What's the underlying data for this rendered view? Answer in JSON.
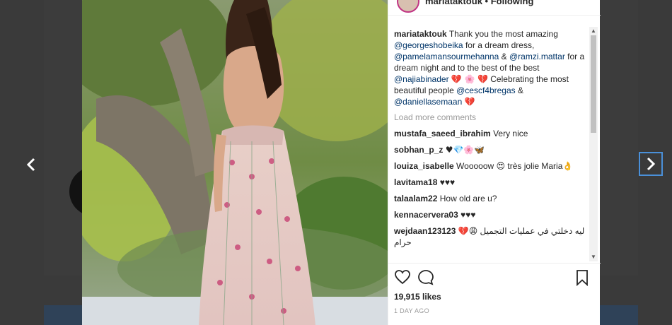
{
  "header": {
    "username": "mariataktouk",
    "separator": "•",
    "follow_label": "Following"
  },
  "caption": {
    "username": "mariataktouk",
    "text_1": "Thank you the most amazing",
    "mention_1": "@georgeshobeika",
    "text_2": "for a dream dress,",
    "mention_2": "@pamelamansourmehanna",
    "text_3": "&",
    "mention_3": "@ramzi.mattar",
    "text_4": "for a dream night and to the best of the best",
    "mention_4": "@najiabinader",
    "emoji_1": "💔 🌸",
    "emoji_2": "💔",
    "text_5": "Celebrating the most beautiful people",
    "mention_5": "@cescf4bregas",
    "text_6": "&",
    "mention_6": "@daniellasemaan",
    "emoji_3": "💔"
  },
  "load_more_label": "Load more comments",
  "comments": [
    {
      "username": "mustafa_saeed_ibrahim",
      "text": "Very nice"
    },
    {
      "username": "sobhan_p_z",
      "text": "♥💎🌸🦋"
    },
    {
      "username": "louiza_isabelle",
      "text": "Wooooow 😍 très jolie Maria👌"
    },
    {
      "username": "lavitama18",
      "text": "♥♥♥"
    },
    {
      "username": "talaalam22",
      "text": "How old are u?"
    },
    {
      "username": "kennacervera03",
      "text": "♥♥♥"
    },
    {
      "username": "wejdaan123123",
      "text": "ليه دخلتي في عمليات التجميل 😩💔 حرام"
    }
  ],
  "likes_label": "19,915 likes",
  "timestamp": "1 DAY AGO",
  "icons": {
    "prev": "chevron-left-icon",
    "next": "chevron-right-icon",
    "like": "heart-icon",
    "comment": "speech-bubble-icon",
    "save": "bookmark-icon"
  },
  "colors": {
    "mention": "#003569",
    "text": "#262626",
    "muted": "#999999",
    "focus_outline": "#4a90d9",
    "story_ring": "#c13584"
  }
}
